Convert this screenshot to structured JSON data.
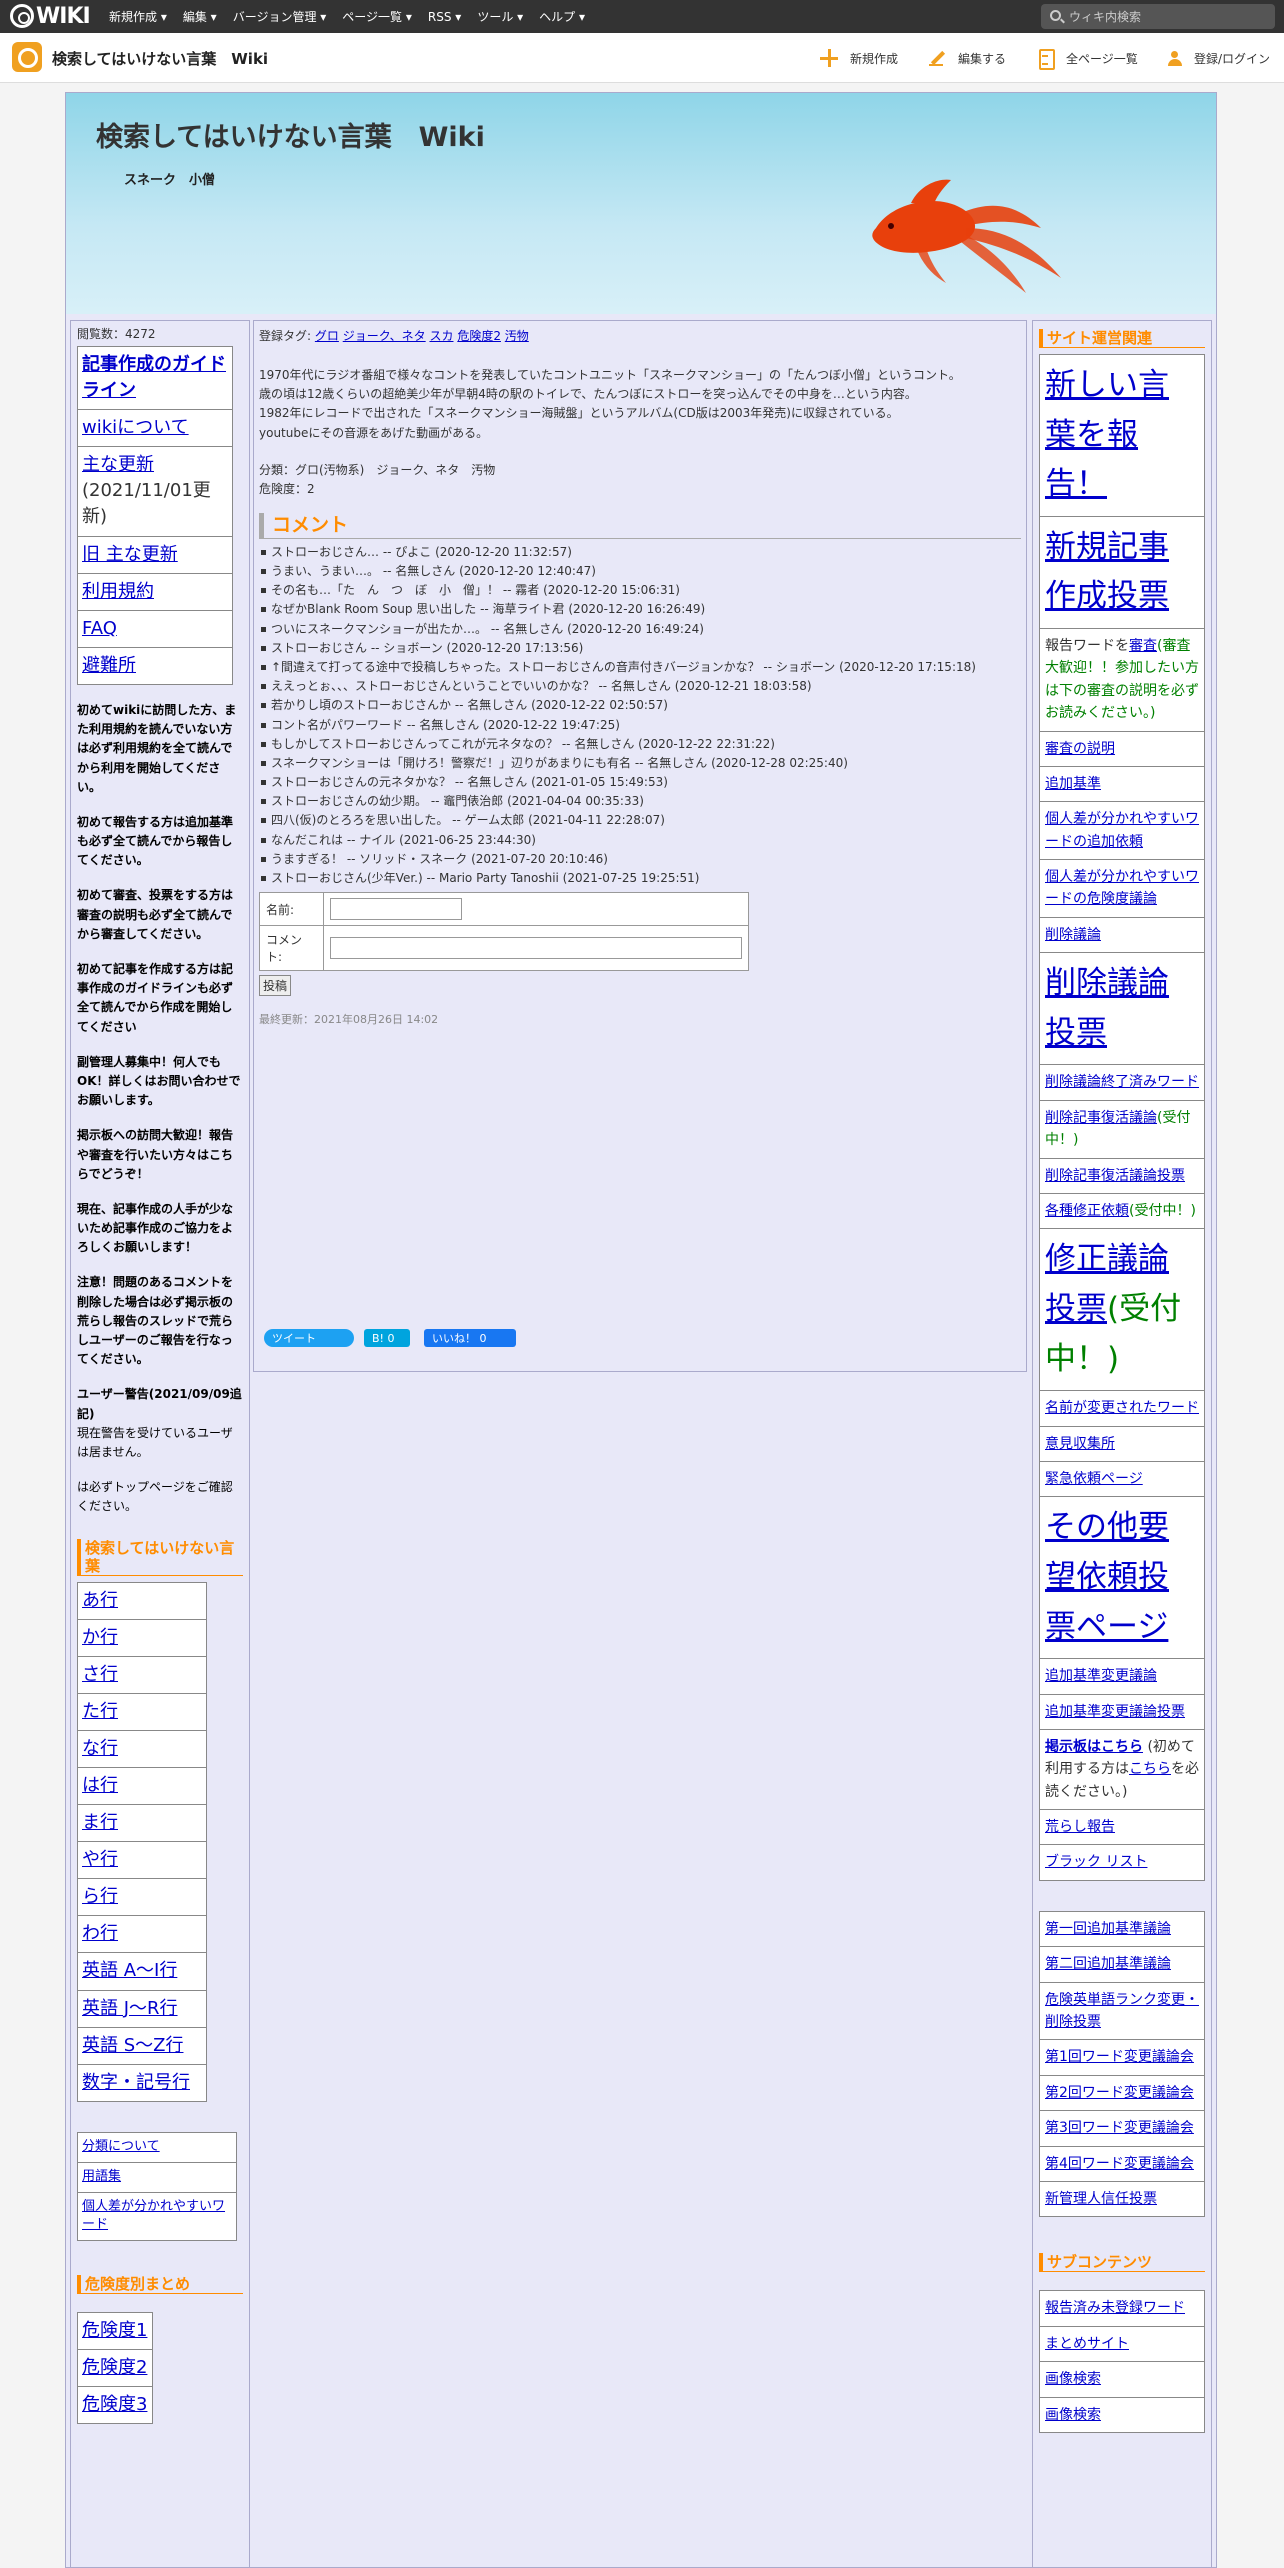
{
  "topbar": {
    "logo": "WIKI",
    "menus": [
      "新規作成 ▾",
      "編集 ▾",
      "バージョン管理 ▾",
      "ページ一覧 ▾",
      "RSS ▾",
      "ツール ▾",
      "ヘルプ ▾"
    ],
    "search_placeholder": "ウィキ内検索"
  },
  "subbar": {
    "wiki_name": "検索してはいけない言葉　Wiki",
    "actions": [
      "新規作成",
      "編集する",
      "全ページ一覧",
      "登録/ログイン"
    ]
  },
  "header": {
    "title": "検索してはいけない言葉　Wiki",
    "subtitle": "スネーク　小僧"
  },
  "left": {
    "views": "閲覧数：4272",
    "links": [
      "記事作成のガイドライン",
      "wikiについて",
      "主な更新",
      "(2021/11/01更新)",
      "旧 主な更新",
      "利用規約",
      "FAQ",
      "避難所"
    ],
    "notes": [
      "初めてwikiに訪問した方、また利用規約を読んでいない方は必ず利用規約を全て読んでから利用を開始してください。",
      "初めて報告する方は追加基準も必ず全て読んでから報告してください。",
      "初めて審査、投票をする方は審査の説明も必ず全て読んでから審査してください。",
      "初めて記事を作成する方は記事作成のガイドラインも必ず全て読んでから作成を開始してください",
      "副管理人募集中！何人でもOK！詳しくはお問い合わせでお願いします。",
      "掲示板への訪問大歓迎！報告や審査を行いたい方々はこちらでどうぞ！",
      "現在、記事作成の人手が少ないため記事作成のご協力をよろしくお願いします！",
      "注意！問題のあるコメントを削除した場合は必ず掲示板の荒らし報告のスレッドで荒らしユーザーのご報告を行なってください。"
    ],
    "warning_title": "ユーザー警告(2021/09/09追記)",
    "warning_text": "現在警告を受けているユーザは居ません。",
    "toppage_note": "は必ずトップページをご確認ください。",
    "section1": "検索してはいけない言葉",
    "rows": [
      "あ行",
      "か行",
      "さ行",
      "た行",
      "な行",
      "は行",
      "ま行",
      "や行",
      "ら行",
      "わ行",
      "英語 A〜I行",
      "英語 J〜R行",
      "英語 S〜Z行",
      "数字・記号行"
    ],
    "misc": [
      "分類について",
      "用語集",
      "個人差が分かれやすいワード"
    ],
    "section2": "危険度別まとめ",
    "danger": [
      "危険度1",
      "危険度2",
      "危険度3"
    ]
  },
  "main": {
    "tags_label": "登録タグ:",
    "tags": [
      "グロ",
      "ジョーク、ネタ",
      "スカ",
      "危険度2",
      "汚物"
    ],
    "body": [
      "1970年代にラジオ番組で様々なコントを発表していたコントユニット「スネークマンショー」の「たんつぼ小僧」というコント。",
      "歳の頃は12歳くらいの超絶美少年が早朝4時の駅のトイレで、たんつぼにストローを突っ込んでその中身を…という内容。",
      "1982年にレコードで出された「スネークマンショー海賊盤」というアルバム(CD版は2003年発売)に収録されている。",
      "youtubeにその音源をあげた動画がある。"
    ],
    "category": "分類：グロ(汚物系)　ジョーク、ネタ　汚物",
    "danger": "危険度：2",
    "comment_title": "コメント",
    "comments": [
      "ストローおじさん… -- ぴよこ (2020-12-20 11:32:57)",
      "うまい、うまい…。 -- 名無しさん (2020-12-20 12:40:47)",
      "その名も…「た　ん　つ　ぼ　小　僧」！ -- 霧者 (2020-12-20 15:06:31)",
      "なぜかBlank Room Soup 思い出した -- 海草ライト君 (2020-12-20 16:26:49)",
      "ついにスネークマンショーが出たか…。 -- 名無しさん (2020-12-20 16:49:24)",
      "ストローおじさん -- ショボーン (2020-12-20 17:13:56)",
      "↑間違えて打ってる途中で投稿しちゃった。ストローおじさんの音声付きバージョンかな？ -- ショボーン (2020-12-20 17:15:18)",
      "ええっとぉ、、、ストローおじさんということでいいのかな？ -- 名無しさん (2020-12-21 18:03:58)",
      "若かりし頃のストローおじさんか -- 名無しさん (2020-12-22 02:50:57)",
      "コント名がパワーワード -- 名無しさん (2020-12-22 19:47:25)",
      "もしかしてストローおじさんってこれが元ネタなの？ -- 名無しさん (2020-12-22 22:31:22)",
      "スネークマンショーは「開けろ！警察だ！」辺りがあまりにも有名 -- 名無しさん (2020-12-28 02:25:40)",
      "ストローおじさんの元ネタかな？ -- 名無しさん (2021-01-05 15:49:53)",
      "ストローおじさんの幼少期。 -- 竈門俵治郎 (2021-04-04 00:35:33)",
      "四八(仮)のとろろを思い出した。 -- ゲーム太郎 (2021-04-11 22:28:07)",
      "なんだこれは -- ナイル (2021-06-25 23:44:30)",
      "うますぎる！ -- ソリッド・スネーク (2021-07-20 20:10:46)",
      "ストローおじさん(少年Ver.) -- Mario Party Tanoshii (2021-07-25 19:25:51)"
    ],
    "form_name": "名前:",
    "form_comment": "コメント:",
    "post": "投稿",
    "updated": "最終更新：2021年08月26日 14:02",
    "tweet": "ツイート",
    "hatena": "B! 0",
    "like": "いいね！ 0"
  },
  "right": {
    "section1": "サイト運営関連",
    "items": [
      "新しい言葉を報告！",
      "新規記事作成投票",
      "報告ワードを",
      "審査",
      "(審査大歓迎！！参加したい方は下の審査の説明を必ずお読みください。)",
      "審査の説明",
      "追加基準",
      "個人差が分かれやすいワードの追加依頼",
      "個人差が分かれやすいワードの危険度議論",
      "削除議論",
      "削除議論投票",
      "削除議論終了済みワード",
      "削除記事復活議論",
      "(受付中！)",
      "削除記事復活議論投票",
      "各種修正依頼",
      "(受付中！)",
      "修正議論投票",
      "(受付中！)",
      "名前が変更されたワード",
      "意見収集所",
      "緊急依頼ページ",
      "その他要望依頼投票ページ",
      "追加基準変更議論",
      "追加基準変更議論投票",
      "掲示板はこちら",
      "(初めて利用する方は",
      "こちら",
      "を必読ください。)",
      "荒らし報告",
      "ブラック リスト"
    ],
    "items2": [
      "第一回追加基準議論",
      "第二回追加基準議論",
      "危険英単語ランク変更・削除投票",
      "第1回ワード変更議論会",
      "第2回ワード変更議論会",
      "第3回ワード変更議論会",
      "第4回ワード変更議論会",
      "新管理人信任投票"
    ],
    "section2": "サブコンテンツ",
    "items3": [
      "報告済み未登録ワード",
      "まとめサイト",
      "画像検索",
      "画像検索"
    ]
  }
}
